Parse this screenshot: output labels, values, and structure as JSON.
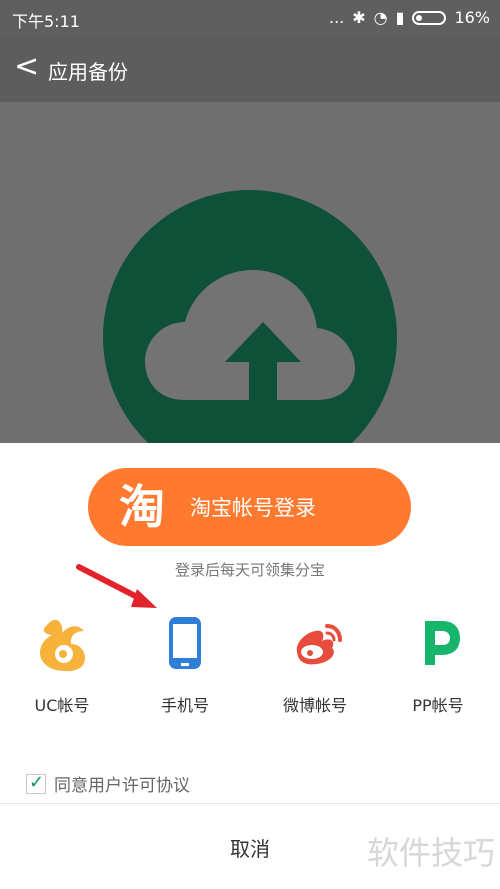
{
  "status_bar": {
    "time": "下午5:11",
    "dots": "...",
    "battery": "16%"
  },
  "app_bar": {
    "back": "<",
    "title": "应用备份"
  },
  "taobao": {
    "icon_char": "淘",
    "label": "淘宝帐号登录",
    "subtitle": "登录后每天可领集分宝"
  },
  "logins": [
    {
      "label": "UC帐号",
      "icon": "squirrel-icon",
      "color": "#f6b23a"
    },
    {
      "label": "手机号",
      "icon": "phone-icon",
      "color": "#2f7fd8"
    },
    {
      "label": "微博帐号",
      "icon": "weibo-icon",
      "color": "#e84c3d"
    },
    {
      "label": "PP帐号",
      "icon": "pp-icon",
      "color": "#17b46c"
    }
  ],
  "agreement": "同意用户许可协议",
  "cancel": "取消",
  "watermark": "软件技巧",
  "colors": {
    "taobao_orange": "#ff7a2f",
    "green_circle": "#0f5138"
  }
}
